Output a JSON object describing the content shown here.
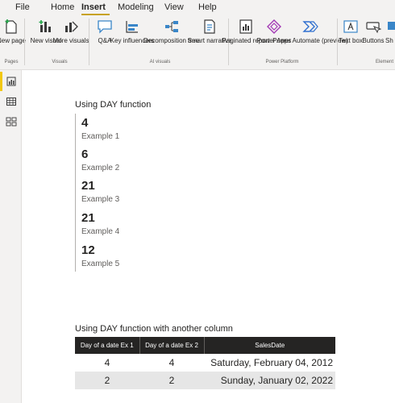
{
  "ribbon_tabs": [
    "File",
    "Home",
    "Insert",
    "Modeling",
    "View",
    "Help"
  ],
  "active_tab": "Insert",
  "ribbon": {
    "buttons": [
      {
        "label": "New page",
        "icon": "new-page-icon",
        "dropdown": true
      },
      {
        "label": "New visual",
        "icon": "new-visual-icon"
      },
      {
        "label": "More visuals",
        "icon": "more-visuals-icon",
        "dropdown": true
      },
      {
        "label": "Q&A",
        "icon": "qna-icon"
      },
      {
        "label": "Key influencers",
        "icon": "key-influencers-icon"
      },
      {
        "label": "Decomposition tree",
        "icon": "decomposition-tree-icon"
      },
      {
        "label": "Smart narrative",
        "icon": "smart-narrative-icon"
      },
      {
        "label": "Paginated report",
        "icon": "paginated-report-icon"
      },
      {
        "label": "Power Apps",
        "icon": "power-apps-icon"
      },
      {
        "label": "Power Automate (preview)",
        "icon": "power-automate-icon"
      },
      {
        "label": "Text box",
        "icon": "text-box-icon"
      },
      {
        "label": "Buttons",
        "icon": "buttons-icon",
        "dropdown": true
      },
      {
        "label": "Sh",
        "icon": "shapes-icon"
      }
    ],
    "groups": [
      "Pages",
      "Visuals",
      "AI visuals",
      "Power Platform",
      "Element"
    ]
  },
  "left_pane": [
    "report-view-icon",
    "data-view-icon",
    "model-view-icon"
  ],
  "card": {
    "title": "Using DAY function",
    "metrics": [
      {
        "value": "4",
        "label": "Example 1"
      },
      {
        "value": "6",
        "label": "Example 2"
      },
      {
        "value": "21",
        "label": "Example 3"
      },
      {
        "value": "21",
        "label": "Example 4"
      },
      {
        "value": "12",
        "label": "Example 5"
      }
    ]
  },
  "table": {
    "title": "Using DAY function with another column",
    "headers": [
      "Day of a date Ex 1",
      "Day of a date Ex 2",
      "SalesDate"
    ],
    "rows": [
      [
        "4",
        "4",
        "Saturday, February 04, 2012"
      ],
      [
        "2",
        "2",
        "Sunday, January 02, 2022"
      ]
    ]
  },
  "colors": {
    "accent": "#c7a21c",
    "header_bg": "#252423",
    "row_alt": "#e6e6e6"
  }
}
